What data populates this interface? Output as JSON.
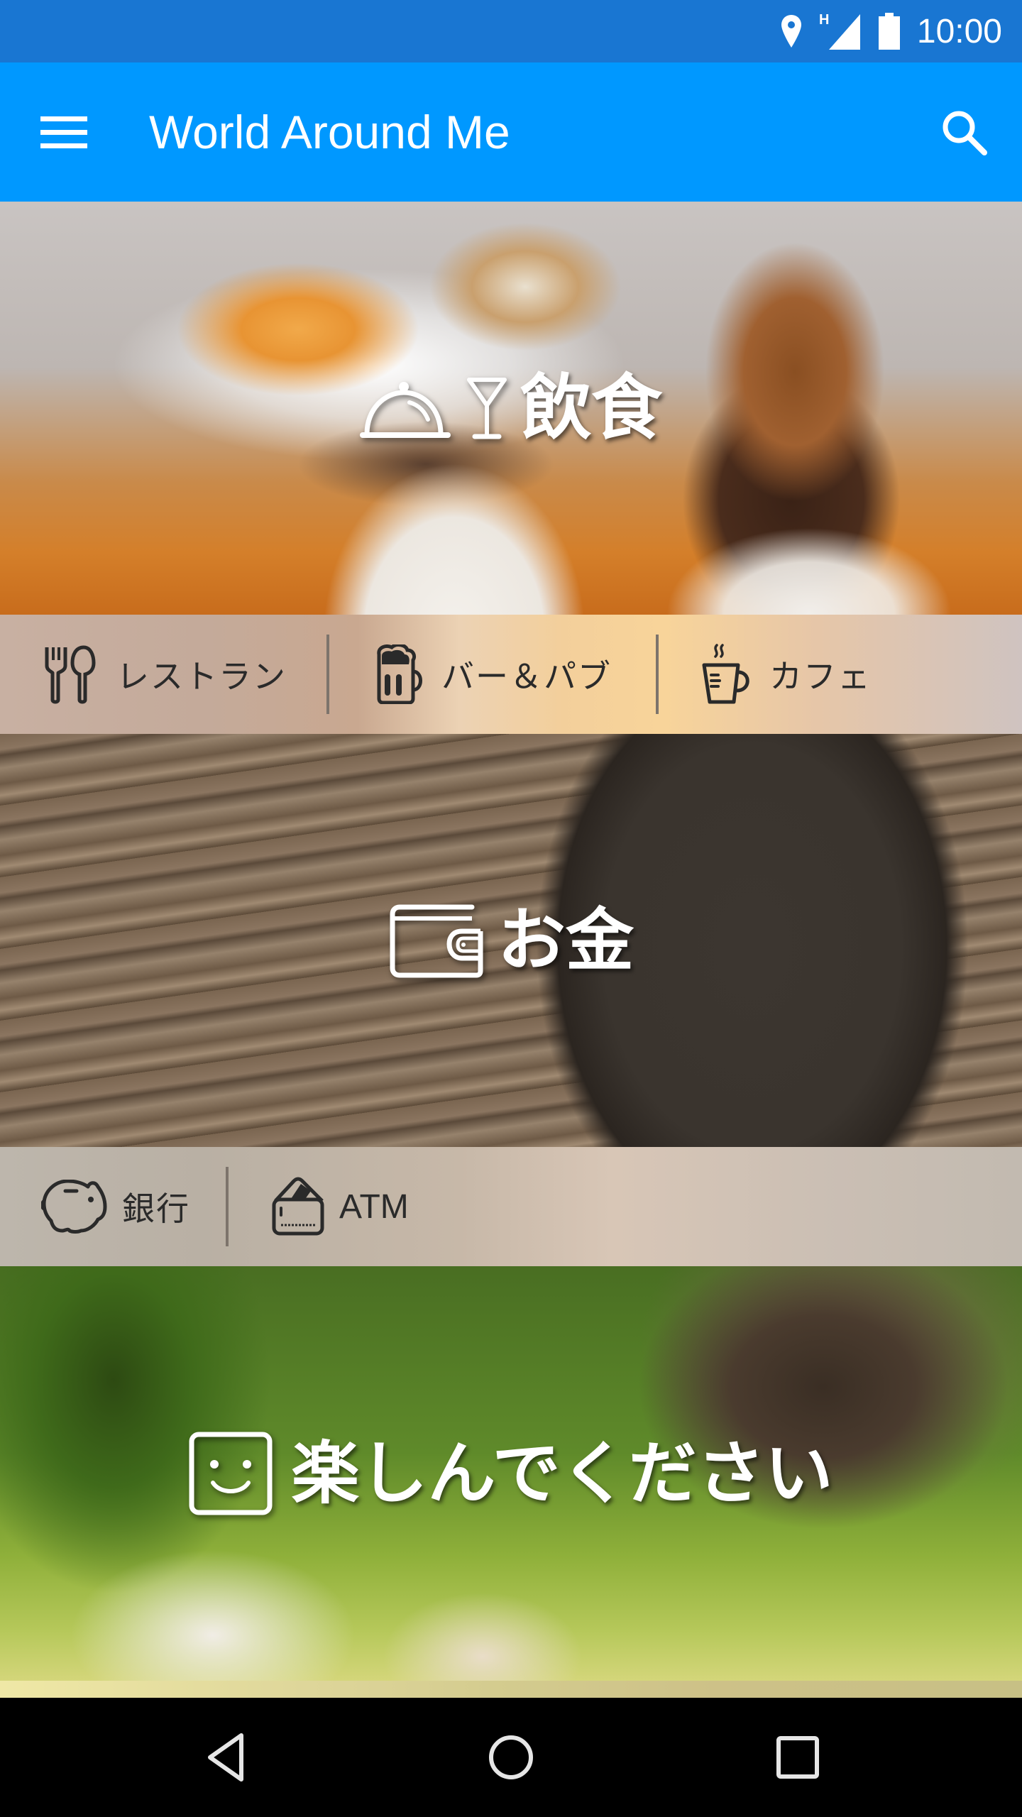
{
  "status_bar": {
    "time": "10:00",
    "icons": [
      "location-icon",
      "signal-h-icon",
      "battery-icon"
    ],
    "network_type": "H",
    "background": "#1976d2"
  },
  "app_bar": {
    "title": "World Around Me",
    "menu_icon": "menu-icon",
    "search_icon": "search-icon",
    "background": "#0098ff"
  },
  "sections": [
    {
      "id": "food",
      "title": "飲食",
      "icons": [
        "cloche-icon",
        "cocktail-glass-icon"
      ],
      "subitems": [
        {
          "label": "レストラン",
          "icon": "fork-spoon-icon"
        },
        {
          "label": "バー＆パブ",
          "icon": "beer-mug-icon"
        },
        {
          "label": "カフェ",
          "icon": "coffee-cup-icon"
        }
      ]
    },
    {
      "id": "money",
      "title": "お金",
      "icons": [
        "wallet-icon"
      ],
      "subitems": [
        {
          "label": "銀行",
          "icon": "piggy-bank-icon"
        },
        {
          "label": "ATM",
          "icon": "atm-card-icon"
        }
      ]
    },
    {
      "id": "fun",
      "title": "楽しんでください",
      "icons": [
        "smiley-icon"
      ],
      "subitems": []
    }
  ],
  "nav_bar": {
    "back": "back-icon",
    "home": "home-icon",
    "recents": "recents-icon"
  }
}
